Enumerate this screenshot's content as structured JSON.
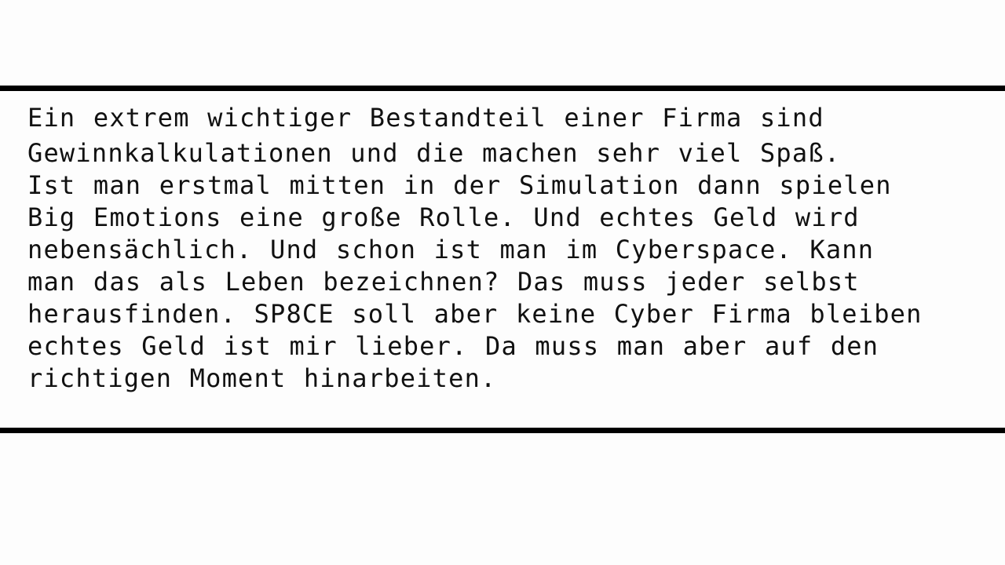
{
  "document": {
    "lines": [
      "Ein extrem wichtiger Bestandteil einer Firma sind",
      "Gewinnkalkulationen und die machen sehr viel Spaß.",
      "Ist man erstmal mitten in der Simulation dann spielen",
      "Big Emotions eine große Rolle. Und echtes Geld wird",
      "nebensächlich. Und schon ist man im Cyberspace. Kann",
      "man das als Leben bezeichnen? Das muss jeder selbst",
      "herausfinden. SP8CE soll aber keine Cyber Firma bleiben",
      "echtes Geld ist mir lieber. Da muss man aber auf den",
      "richtigen Moment hinarbeiten."
    ]
  },
  "colors": {
    "background": "#fdfdfd",
    "rule": "#000000",
    "text": "#111111"
  }
}
